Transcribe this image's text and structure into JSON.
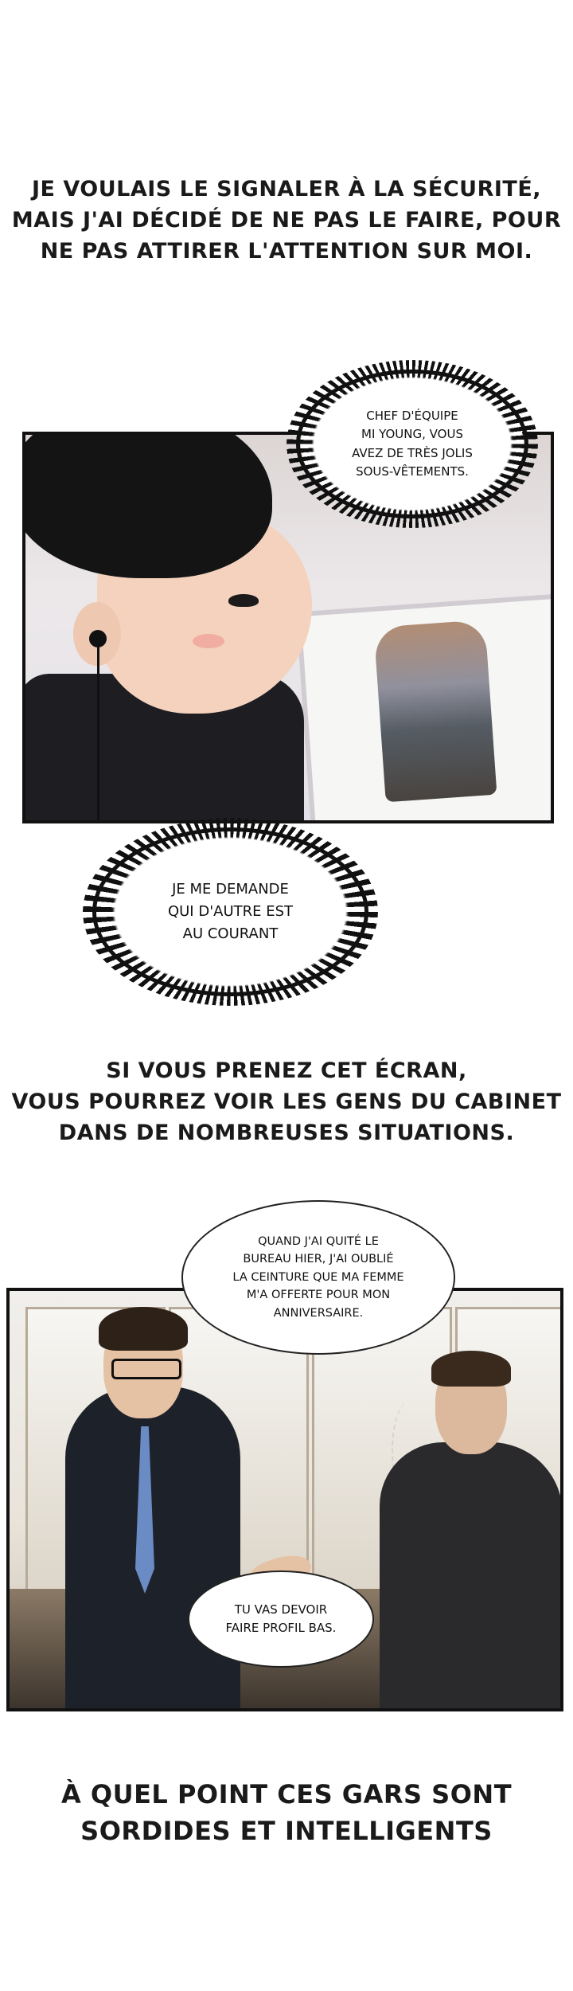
{
  "narration_top": [
    "Je voulais le signaler à la sécurité,",
    "mais j'ai décidé de ne pas le faire, pour",
    "ne pas attirer l'attention sur moi."
  ],
  "bubble_1": [
    "Chef d'équipe",
    "Mi Young, vous",
    "avez de très jolis",
    "sous-vêtements."
  ],
  "bubble_2": [
    "Je me demande",
    "qui d'autre est",
    "au courant"
  ],
  "narration_middle": [
    "Si vous prenez cet écran,",
    "vous pourrez voir les gens du cabinet",
    "dans de nombreuses situations."
  ],
  "bubble_3": [
    "Quand j'ai quité le",
    "bureau hier, j'ai oublié",
    "la ceinture que ma femme",
    "m'a offerte pour mon",
    "anniversaire."
  ],
  "bubble_4": [
    "Tu vas devoir",
    "faire profil bas."
  ],
  "narration_bottom": [
    "À quel point ces gars sont",
    "sordides et intelligents"
  ]
}
